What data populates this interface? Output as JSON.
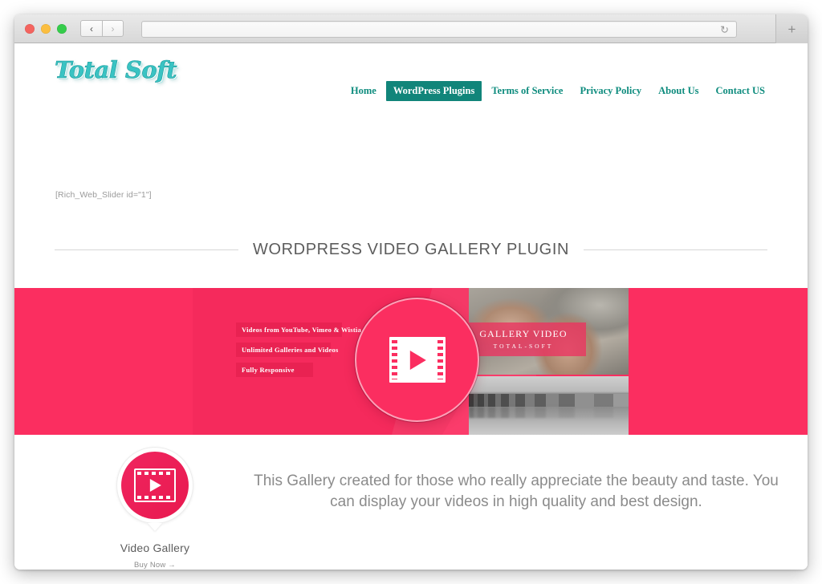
{
  "browser": {
    "traffic_lights": [
      "close",
      "minimize",
      "zoom"
    ],
    "back_label": "‹",
    "forward_label": "›",
    "address_value": "",
    "address_placeholder": "",
    "reload_label": "↻",
    "newtab_label": "+"
  },
  "site": {
    "logo_text": "Total Soft",
    "nav": [
      {
        "label": "Home",
        "active": false
      },
      {
        "label": "WordPress Plugins",
        "active": true
      },
      {
        "label": "Terms of Service",
        "active": false
      },
      {
        "label": "Privacy Policy",
        "active": false
      },
      {
        "label": "About Us",
        "active": false
      },
      {
        "label": "Contact US",
        "active": false
      }
    ],
    "shortcode": "[Rich_Web_Slider id=\"1\"]",
    "section_title": "WORDPRESS VIDEO GALLERY PLUGIN"
  },
  "banner": {
    "background_color": "#fb2e60",
    "features": [
      "Videos from YouTube, Vimeo & Wistia",
      "Unlimited Galleries and Videos",
      "Fully Responsive"
    ],
    "center_icon": "film-play-icon",
    "caption_title": "GALLERY VIDEO",
    "caption_subtitle": "TOTAL-SOFT"
  },
  "product": {
    "icon": "video-gallery-icon",
    "name": "Video Gallery",
    "buy_label": "Buy Now →",
    "description": "This Gallery created for those who really appreciate the beauty and taste. You can display your videos in high quality and best design.",
    "accent_color": "#ec1d52"
  }
}
